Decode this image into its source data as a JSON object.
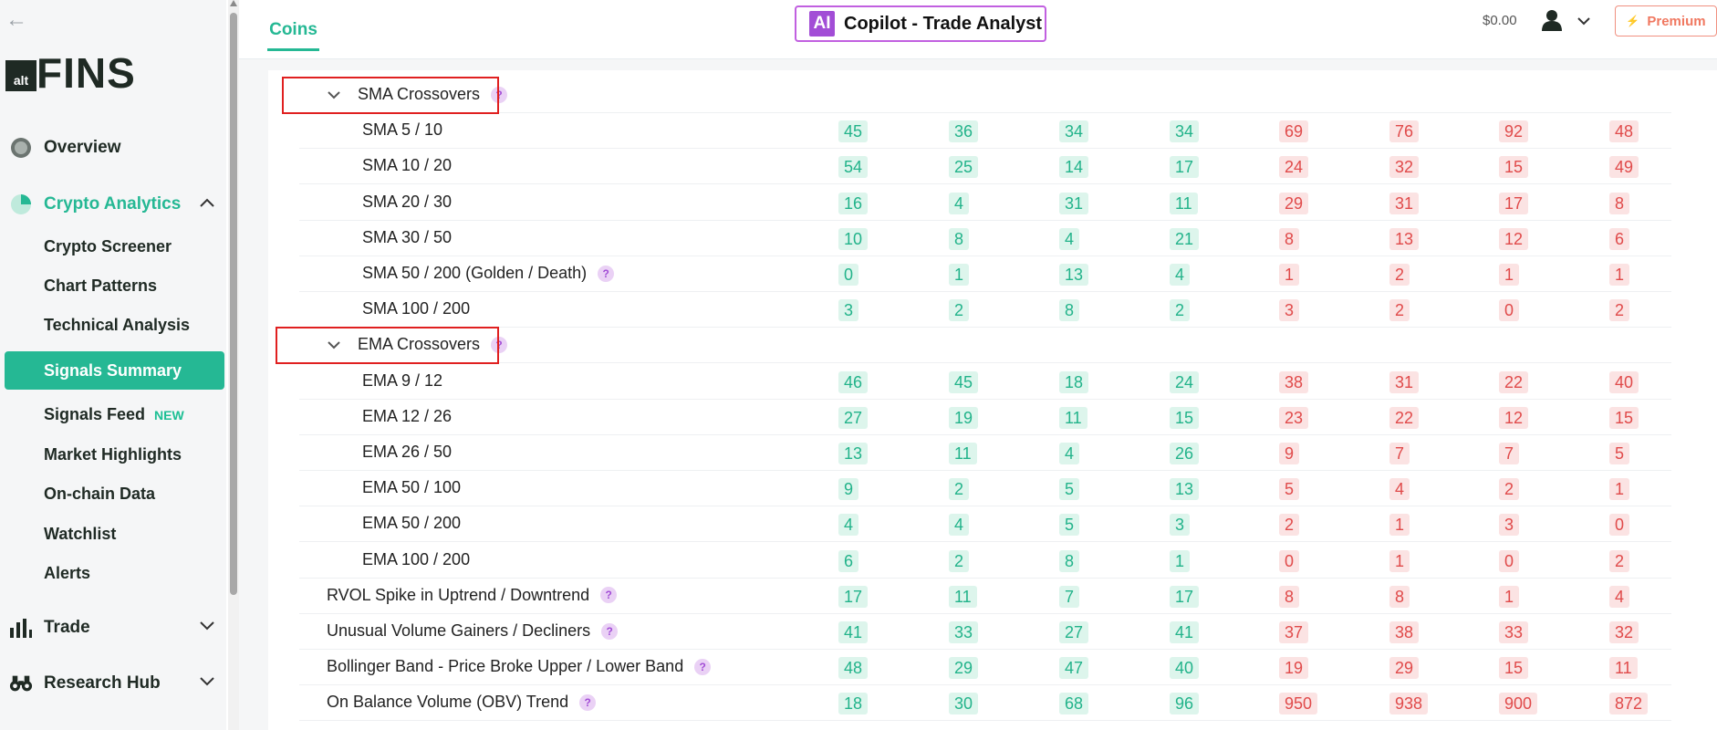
{
  "sidebar": {
    "back_icon": "back-arrow-icon",
    "logo": {
      "alt": "alt",
      "fins": "FINS"
    },
    "items": [
      {
        "label": "Overview",
        "icon": "overview-icon"
      },
      {
        "label": "Crypto Analytics",
        "icon": "pie-icon"
      },
      {
        "label": "Trade",
        "icon": "bar-chart-icon"
      },
      {
        "label": "Research Hub",
        "icon": "binoculars-icon"
      }
    ],
    "sub_items": [
      "Crypto Screener",
      "Chart Patterns",
      "Technical Analysis",
      "Signals Summary",
      "Signals Feed",
      "Market Highlights",
      "On-chain Data",
      "Watchlist",
      "Alerts"
    ],
    "new_badge": "NEW"
  },
  "header": {
    "tab": "Coins",
    "copilot_badge": "AI",
    "copilot_label": "Copilot - Trade Analyst",
    "balance": "$0.00",
    "premium_label": "Premium"
  },
  "colors": {
    "accent": "#25b894",
    "positive": "#22b38a",
    "negative": "#e04a4a",
    "copilot": "#a24dd6",
    "premium": "#f07860"
  },
  "table": {
    "groups": [
      {
        "label": "SMA Crossovers",
        "rows": [
          {
            "label": "SMA 5 / 10",
            "values": [
              "45",
              "36",
              "34",
              "34",
              "69",
              "76",
              "92",
              "48"
            ]
          },
          {
            "label": "SMA 10 / 20",
            "values": [
              "54",
              "25",
              "14",
              "17",
              "24",
              "32",
              "15",
              "49"
            ]
          },
          {
            "label": "SMA 20 / 30",
            "values": [
              "16",
              "4",
              "31",
              "11",
              "29",
              "31",
              "17",
              "8"
            ]
          },
          {
            "label": "SMA 30 / 50",
            "values": [
              "10",
              "8",
              "4",
              "21",
              "8",
              "13",
              "12",
              "6"
            ]
          },
          {
            "label": "SMA 50 / 200 (Golden / Death)",
            "values": [
              "0",
              "1",
              "13",
              "4",
              "1",
              "2",
              "1",
              "1"
            ],
            "help": true
          },
          {
            "label": "SMA 100 / 200",
            "values": [
              "3",
              "2",
              "8",
              "2",
              "3",
              "2",
              "0",
              "2"
            ]
          }
        ]
      },
      {
        "label": "EMA Crossovers",
        "rows": [
          {
            "label": "EMA 9 / 12",
            "values": [
              "46",
              "45",
              "18",
              "24",
              "38",
              "31",
              "22",
              "40"
            ]
          },
          {
            "label": "EMA 12 / 26",
            "values": [
              "27",
              "19",
              "11",
              "15",
              "23",
              "22",
              "12",
              "15"
            ]
          },
          {
            "label": "EMA 26 / 50",
            "values": [
              "13",
              "11",
              "4",
              "26",
              "9",
              "7",
              "7",
              "5"
            ]
          },
          {
            "label": "EMA 50 / 100",
            "values": [
              "9",
              "2",
              "5",
              "13",
              "5",
              "4",
              "2",
              "1"
            ]
          },
          {
            "label": "EMA 50 / 200",
            "values": [
              "4",
              "4",
              "5",
              "3",
              "2",
              "1",
              "3",
              "0"
            ]
          },
          {
            "label": "EMA 100 / 200",
            "values": [
              "6",
              "2",
              "8",
              "1",
              "0",
              "1",
              "0",
              "2"
            ]
          }
        ]
      }
    ],
    "other_rows": [
      {
        "label": "RVOL Spike in Uptrend / Downtrend",
        "values": [
          "17",
          "11",
          "7",
          "17",
          "8",
          "8",
          "1",
          "4"
        ]
      },
      {
        "label": "Unusual Volume Gainers / Decliners",
        "values": [
          "41",
          "33",
          "27",
          "41",
          "37",
          "38",
          "33",
          "32"
        ]
      },
      {
        "label": "Bollinger Band - Price Broke Upper / Lower Band",
        "values": [
          "48",
          "29",
          "47",
          "40",
          "19",
          "29",
          "15",
          "11"
        ]
      },
      {
        "label": "On Balance Volume (OBV) Trend",
        "values": [
          "18",
          "30",
          "68",
          "96",
          "950",
          "938",
          "900",
          "872"
        ]
      }
    ]
  }
}
